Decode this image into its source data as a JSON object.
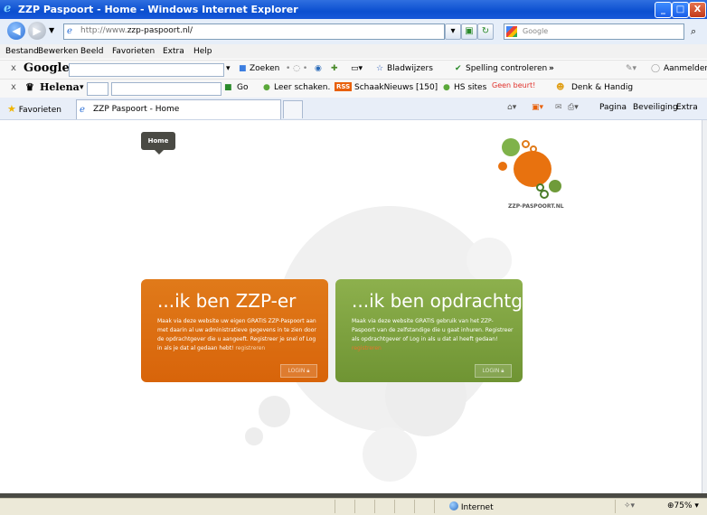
{
  "window": {
    "title": "ZZP Paspoort - Home - Windows Internet Explorer",
    "min": "_",
    "max": "□",
    "close": "X"
  },
  "address": {
    "url_prefix": "http://www.",
    "url_host": "zzp-paspoort.nl/",
    "search_placeholder": "Google"
  },
  "menu": [
    "Bestand",
    "Bewerken",
    "Beeld",
    "Favorieten",
    "Extra",
    "Help"
  ],
  "google_toolbar": {
    "brand": "Google",
    "search_label": "Zoeken",
    "bookmarks": "Bladwijzers",
    "spell": "Spelling controleren",
    "more": "»",
    "signin": "Aanmelden"
  },
  "custom_toolbar": {
    "brand": "Helena",
    "go": "Go",
    "chess": "Leer schaken.",
    "rss_label": "RSS",
    "news": "SchaakNieuws [150]",
    "hs": "HS sites",
    "turn": "Geen beurt!",
    "handig": "Denk & Handig"
  },
  "tabs": {
    "favorites": "Favorieten",
    "active_tab": "ZZP Paspoort - Home"
  },
  "commandbar": {
    "page": "Pagina",
    "security": "Beveiliging",
    "extra": "Extra"
  },
  "page": {
    "home_label": "Home",
    "logo_text": "ZZP-PASPOORT.NL",
    "cards": [
      {
        "title": "...ik ben ZZP-er",
        "body": "Maak via deze website uw eigen GRATIS ZZP-Paspoort aan met daarin al uw administratieve gegevens in te zien door de opdrachtgever die u aangeeft. Registreer je snel of Log in als je dat al gedaan hebt!",
        "link": "registreren",
        "login": "LOGIN"
      },
      {
        "title": "...ik ben opdrachtgever",
        "body": "Maak via deze website GRATIS gebruik van het ZZP-Paspoort van de zelfstandige die u gaat inhuren. Registreer als opdrachtgever of Log in als u dat al heeft gedaan!",
        "link": "registreren",
        "login": "LOGIN"
      }
    ]
  },
  "status": {
    "zone": "Internet",
    "zoom": "75%"
  },
  "colors": {
    "orange": "#d8640a",
    "green": "#7a9e3b",
    "ie_blue": "#0b4fd0"
  }
}
